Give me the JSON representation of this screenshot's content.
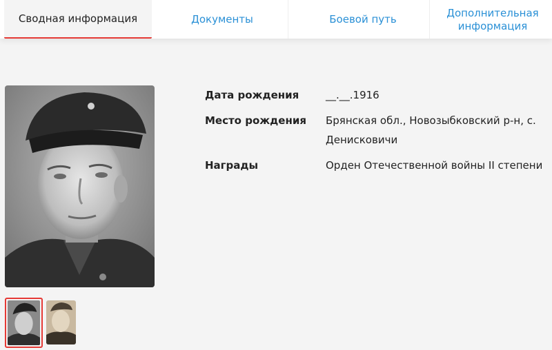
{
  "tabs": [
    {
      "label": "Сводная информация",
      "active": true
    },
    {
      "label": "Документы",
      "active": false
    },
    {
      "label": "Боевой путь",
      "active": false
    },
    {
      "label": "Дополнительная информация",
      "active": false
    }
  ],
  "info": {
    "birth_date": {
      "label": "Дата рождения",
      "value": "__.__.1916"
    },
    "birth_place": {
      "label": "Место рождения",
      "value": "Брянская обл., Новозыбковский р-н, с. Денисковичи"
    },
    "awards": {
      "label": "Награды",
      "value": "Орден Отечественной войны II степени"
    }
  },
  "colors": {
    "accent": "#e53935",
    "link": "#2a90d6",
    "background": "#f4f4f4"
  },
  "icons": {
    "main_photo": "portrait-photo",
    "thumb_1": "portrait-photo-thumbnail",
    "thumb_2": "portrait-photo-thumbnail"
  }
}
